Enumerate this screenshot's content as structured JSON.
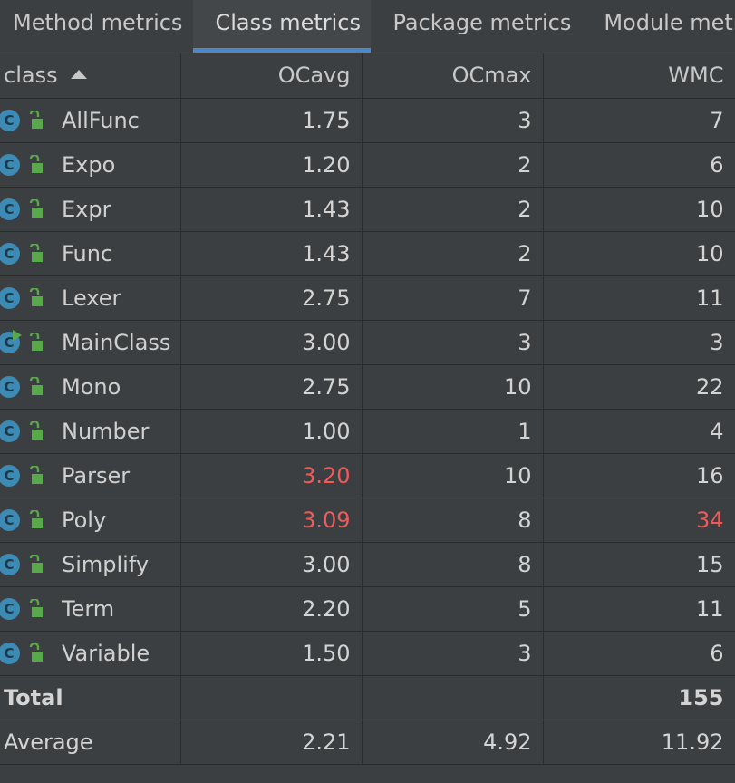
{
  "tabs": [
    {
      "label": "Method metrics",
      "active": false
    },
    {
      "label": "Class metrics",
      "active": true
    },
    {
      "label": "Package metrics",
      "active": false
    },
    {
      "label": "Module metrics",
      "active": false
    }
  ],
  "table": {
    "columns": [
      "class",
      "OCavg",
      "OCmax",
      "WMC"
    ],
    "sort": {
      "column": "class",
      "direction": "ascending"
    },
    "rows": [
      {
        "name": "AllFunc",
        "ocavg": "1.75",
        "ocmax": "3",
        "wmc": "7",
        "icon": "class-icon",
        "highlight_ocavg": false,
        "highlight_wmc": false
      },
      {
        "name": "Expo",
        "ocavg": "1.20",
        "ocmax": "2",
        "wmc": "6",
        "icon": "class-icon",
        "highlight_ocavg": false,
        "highlight_wmc": false
      },
      {
        "name": "Expr",
        "ocavg": "1.43",
        "ocmax": "2",
        "wmc": "10",
        "icon": "class-icon",
        "highlight_ocavg": false,
        "highlight_wmc": false
      },
      {
        "name": "Func",
        "ocavg": "1.43",
        "ocmax": "2",
        "wmc": "10",
        "icon": "class-icon",
        "highlight_ocavg": false,
        "highlight_wmc": false
      },
      {
        "name": "Lexer",
        "ocavg": "2.75",
        "ocmax": "7",
        "wmc": "11",
        "icon": "class-icon",
        "highlight_ocavg": false,
        "highlight_wmc": false
      },
      {
        "name": "MainClass",
        "ocavg": "3.00",
        "ocmax": "3",
        "wmc": "3",
        "icon": "runnable-class-icon",
        "highlight_ocavg": false,
        "highlight_wmc": false
      },
      {
        "name": "Mono",
        "ocavg": "2.75",
        "ocmax": "10",
        "wmc": "22",
        "icon": "class-icon",
        "highlight_ocavg": false,
        "highlight_wmc": false
      },
      {
        "name": "Number",
        "ocavg": "1.00",
        "ocmax": "1",
        "wmc": "4",
        "icon": "class-icon",
        "highlight_ocavg": false,
        "highlight_wmc": false
      },
      {
        "name": "Parser",
        "ocavg": "3.20",
        "ocmax": "10",
        "wmc": "16",
        "icon": "class-icon",
        "highlight_ocavg": true,
        "highlight_wmc": false
      },
      {
        "name": "Poly",
        "ocavg": "3.09",
        "ocmax": "8",
        "wmc": "34",
        "icon": "class-icon",
        "highlight_ocavg": true,
        "highlight_wmc": true
      },
      {
        "name": "Simplify",
        "ocavg": "3.00",
        "ocmax": "8",
        "wmc": "15",
        "icon": "class-icon",
        "highlight_ocavg": false,
        "highlight_wmc": false
      },
      {
        "name": "Term",
        "ocavg": "2.20",
        "ocmax": "5",
        "wmc": "11",
        "icon": "class-icon",
        "highlight_ocavg": false,
        "highlight_wmc": false
      },
      {
        "name": "Variable",
        "ocavg": "1.50",
        "ocmax": "3",
        "wmc": "6",
        "icon": "class-icon",
        "highlight_ocavg": false,
        "highlight_wmc": false
      }
    ],
    "total": {
      "label": "Total",
      "ocavg": "",
      "ocmax": "",
      "wmc": "155"
    },
    "average": {
      "label": "Average",
      "ocavg": "2.21",
      "ocmax": "4.92",
      "wmc": "11.92"
    }
  },
  "colors": {
    "background": "#3c3f41",
    "tab_underline": "#4a88c7",
    "warning_value": "#ef5b5b",
    "class_icon": "#3d8bb5",
    "lock_icon": "#59a84b"
  },
  "icons": {
    "class_glyph": "C"
  }
}
